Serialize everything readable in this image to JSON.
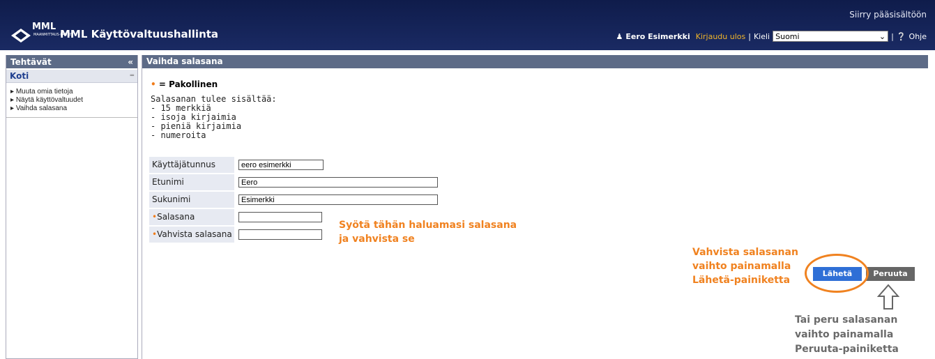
{
  "header": {
    "skip_link": "Siirry pääsisältöön",
    "logo_text": "MML",
    "logo_sub": "MAANMITTAUS-LAITOS",
    "title": "MML Käyttövaltuushallinta",
    "user_name": "Eero Esimerkki",
    "logout": "Kirjaudu ulos",
    "separator": "|",
    "lang_label": "Kieli",
    "lang_value": "Suomi",
    "help": "Ohje"
  },
  "sidebar": {
    "title": "Tehtävät",
    "collapse_glyph": "«",
    "section": "Koti",
    "section_glyph": "═",
    "items": [
      "Muuta omia tietoja",
      "Näytä käyttövaltuudet",
      "Vaihda salasana"
    ]
  },
  "main": {
    "title": "Vaihda salasana",
    "required_legend": "= Pakollinen",
    "requirements": [
      "Salasanan tulee sisältää:",
      "- 15 merkkiä",
      "- isoja kirjaimia",
      "- pieniä kirjaimia",
      "- numeroita"
    ],
    "fields": {
      "username_label": "Käyttäjätunnus",
      "username_value": "eero esimerkki",
      "firstname_label": "Etunimi",
      "firstname_value": "Eero",
      "lastname_label": "Sukunimi",
      "lastname_value": "Esimerkki",
      "password_label": "Salasana",
      "password_value": "",
      "confirm_label": "Vahvista salasana",
      "confirm_value": ""
    },
    "send_label": "Lähetä",
    "cancel_label": "Peruuta"
  },
  "annotations": {
    "password_hint": [
      "Syötä tähän haluamasi salasana",
      "ja vahvista se"
    ],
    "send_hint": [
      "Vahvista salasanan",
      "vaihto painamalla",
      "Lähetä-painiketta"
    ],
    "cancel_hint": [
      "Tai peru salasanan",
      "vaihto painamalla",
      "Peruuta-painiketta"
    ]
  },
  "colors": {
    "header": "#13214f",
    "panel_head": "#5d6b87",
    "accent_orange": "#f08220",
    "send_button": "#2f6fd6"
  }
}
